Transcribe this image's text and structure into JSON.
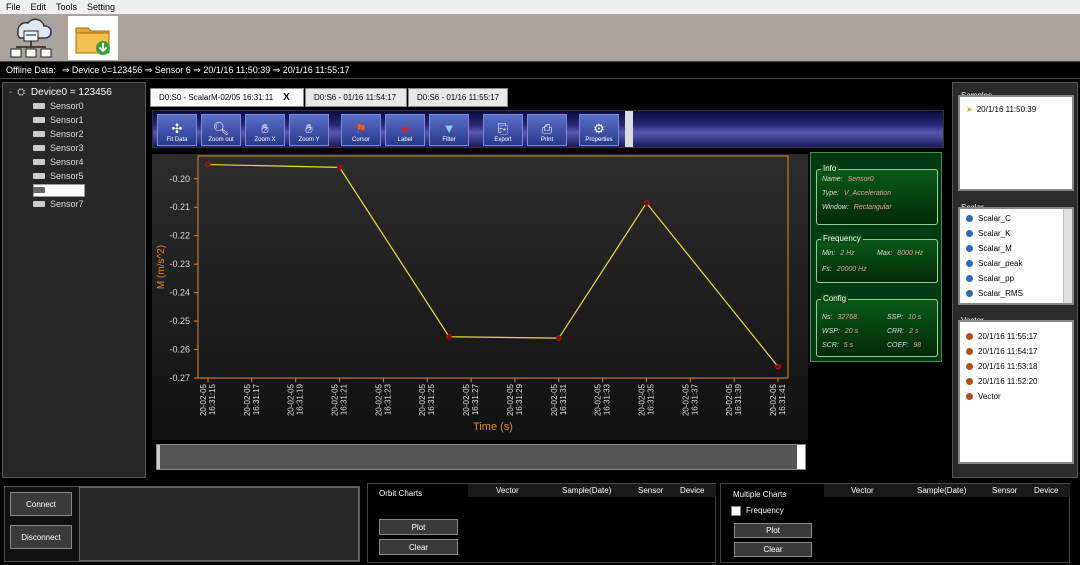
{
  "menu": [
    "File",
    "Edit",
    "Tools",
    "Setting"
  ],
  "address": {
    "label": "Offline Data:",
    "path": "⇒ Device 0=123456 ⇒ Sensor 6 ⇒ 20/1/16 11:50:39 ⇒ 20/1/16 11:55:17"
  },
  "tree": {
    "root": "Device0 = 123456",
    "sensors": [
      "Sensor0",
      "Sensor1",
      "Sensor2",
      "Sensor3",
      "Sensor4",
      "Sensor5",
      "",
      "Sensor7"
    ]
  },
  "tabs": [
    {
      "label": "D0:S0 - ScalarM-02/05 16:31:11",
      "close": "X",
      "active": true
    },
    {
      "label": "D0:S6 - 01/16 11:54:17",
      "active": false
    },
    {
      "label": "D0:S6 - 01/16 11:55:17",
      "active": false
    }
  ],
  "ribbon": [
    "Fit Data",
    "Zoom out",
    "Zoom X",
    "Zoom Y",
    "Cursor",
    "Label",
    "Filter",
    "Export",
    "Print",
    "Properties"
  ],
  "chart_data": {
    "type": "line",
    "x": [
      "20-02-05 16:31:15",
      "20-02-05 16:31:21",
      "20-02-05 16:31:26",
      "20-02-05 16:31:31",
      "20-02-05 16:31:35",
      "20-02-05 16:31:41"
    ],
    "values": [
      -0.195,
      -0.196,
      -0.2555,
      -0.256,
      -0.2085,
      -0.266
    ],
    "xticks": [
      "20-02-05 16:31:15",
      "20-02-05 16:31:17",
      "20-02-05 16:31:19",
      "20-02-05 16:31:21",
      "20-02-05 16:31:23",
      "20-02-05 16:31:25",
      "20-02-05 16:31:27",
      "20-02-05 16:31:29",
      "20-02-05 16:31:31",
      "20-02-05 16:31:33",
      "20-02-05 16:31:35",
      "20-02-05 16:31:37",
      "20-02-05 16:31:39",
      "20-02-05 16:31:41"
    ],
    "yticks": [
      "-0.20",
      "-0.21",
      "-0.22",
      "-0.23",
      "-0.24",
      "-0.25",
      "-0.26",
      "-0.27"
    ],
    "ylim": [
      -0.27,
      -0.192
    ],
    "xlabel": "Time (s)",
    "ylabel": "M (m/s^2)",
    "line_color": "#e8e030",
    "marker_color": "#8a0a0a",
    "axis_color": "#e08a20"
  },
  "info": {
    "title": "Info",
    "name_k": "Name:",
    "name_v": "Sensor0",
    "type_k": "Type:",
    "type_v": "V_Acceleration",
    "window_k": "Window:",
    "window_v": "Rectangular"
  },
  "frequency": {
    "title": "Frequency",
    "min_k": "Min:",
    "min_v": "2 Hz",
    "max_k": "Max:",
    "max_v": "8000 Hz",
    "fs_k": "Fs:",
    "fs_v": "20000 Hz"
  },
  "config": {
    "title": "Config",
    "ns_k": "Ns:",
    "ns_v": "32768",
    "ssp_k": "SSP:",
    "ssp_v": "10 s",
    "wsp_k": "WSP:",
    "wsp_v": "20 s",
    "crr_k": "CRR:",
    "crr_v": "2 s",
    "scr_k": "SCR:",
    "scr_v": "5 s",
    "coef_k": "COEF:",
    "coef_v": "98"
  },
  "samples": {
    "title": "Samples",
    "items": [
      "20/1/16 11:50:39"
    ]
  },
  "scalar": {
    "title": "Scalar",
    "items": [
      "Scalar_C",
      "Scalar_K",
      "Scalar_M",
      "Scalar_peak",
      "Scalar_pp",
      "Scalar_RMS"
    ]
  },
  "vector": {
    "title": "Vector",
    "items": [
      "20/1/16 11:55:17",
      "20/1/16 11:54:17",
      "20/1/16 11:53:18",
      "20/1/16 11:52:20",
      "Vector"
    ]
  },
  "bottom": {
    "connect": "Connect",
    "disconnect": "Disconnect",
    "orbit_title": "Orbit Charts",
    "orbit_cols": [
      "Vector",
      "Sample(Date)",
      "Sensor",
      "Device"
    ],
    "orbit_plot": "Plot",
    "orbit_clear": "Clear",
    "multi_title": "Multiple Charts",
    "multi_cols": [
      "Vector",
      "Sample(Date)",
      "Sensor",
      "Device"
    ],
    "frequency_label": "Frequency",
    "multi_plot": "Plot",
    "multi_clear": "Clear"
  },
  "colors": {
    "scalar_dot": "#2a6ab8",
    "vector_dot": "#b05020",
    "sample_arrow": "#e8a020"
  }
}
